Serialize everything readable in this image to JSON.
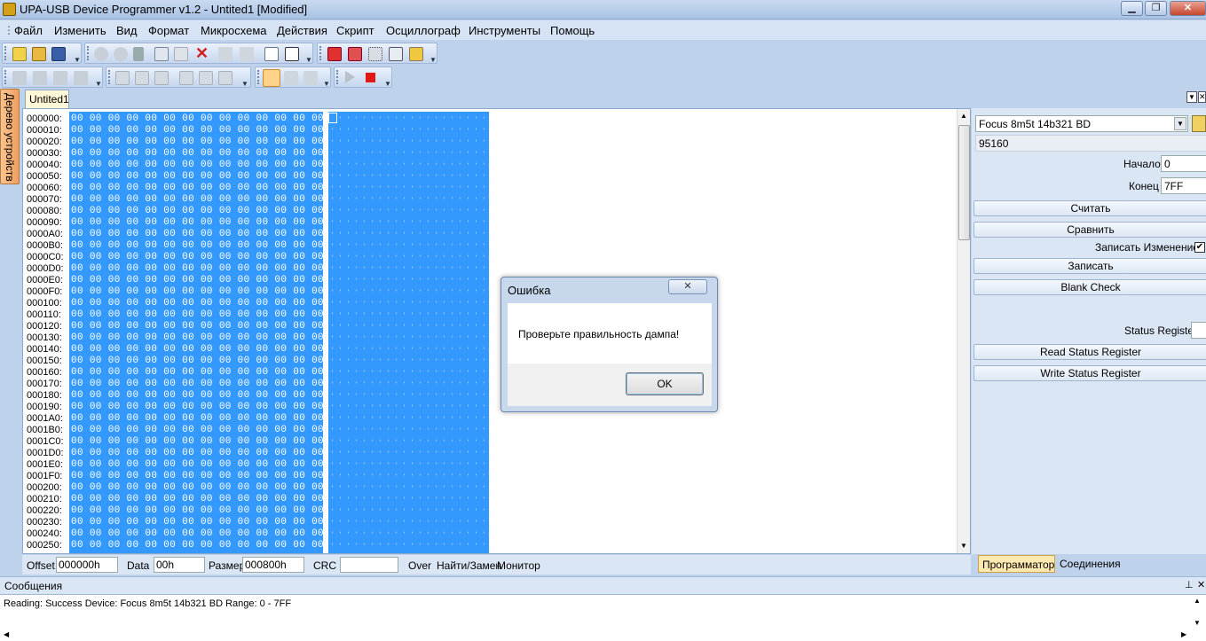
{
  "window": {
    "title": "UPA-USB Device Programmer v1.2 - Untited1 [Modified]",
    "min_glyph": "▁",
    "max_glyph": "❐",
    "close_glyph": "✕"
  },
  "menu": [
    "Файл",
    "Изменить",
    "Вид",
    "Формат",
    "Микросхема",
    "Действия",
    "Скрипт",
    "Осциллограф",
    "Инструменты",
    "Помощь"
  ],
  "tabs": {
    "document": "Untited1",
    "side": "Дерево устройств"
  },
  "hex": {
    "offsets": [
      "000000:",
      "000010:",
      "000020:",
      "000030:",
      "000040:",
      "000050:",
      "000060:",
      "000070:",
      "000080:",
      "000090:",
      "0000A0:",
      "0000B0:",
      "0000C0:",
      "0000D0:",
      "0000E0:",
      "0000F0:",
      "000100:",
      "000110:",
      "000120:",
      "000130:",
      "000140:",
      "000150:",
      "000160:",
      "000170:",
      "000180:",
      "000190:",
      "0001A0:",
      "0001B0:",
      "0001C0:",
      "0001D0:",
      "0001E0:",
      "0001F0:",
      "000200:",
      "000210:",
      "000220:",
      "000230:",
      "000240:",
      "000250:"
    ],
    "byte_row": "00 00 00 00 00 00 00 00 00 00 00 00 00 00 00 00"
  },
  "statusbar": {
    "offset_label": "Offset",
    "offset_value": "000000h",
    "data_label": "Data",
    "data_value": "00h",
    "size_label": "Размер",
    "size_value": "000800h",
    "crc_label": "CRC",
    "crc_value": "",
    "over_label": "Over",
    "find_label": "Найти/Замен",
    "monitor_label": "Монитор"
  },
  "right_panel": {
    "device": "Focus 8m5t 14b321 BD",
    "device_id": "95160",
    "start_label": "Начало",
    "start_value": "0",
    "end_label": "Конец",
    "end_value": "7FF",
    "read_button": "Считать",
    "compare_button": "Сравнить",
    "write_changes_label": "Записать Изменение",
    "write_button": "Записать",
    "blank_check_button": "Blank Check",
    "status_register_label": "Status Register",
    "read_status_button": "Read Status Register",
    "write_status_button": "Write Status Register",
    "tab_programmer": "Программатор",
    "tab_connections": "Соединения"
  },
  "messages": {
    "title": "Сообщения",
    "line": "Reading: Success  Device: Focus 8m5t 14b321 BD Range: 0 - 7FF"
  },
  "dialog": {
    "title": "Ошибка",
    "message": "Проверьте правильность дампа!",
    "ok": "OK"
  }
}
